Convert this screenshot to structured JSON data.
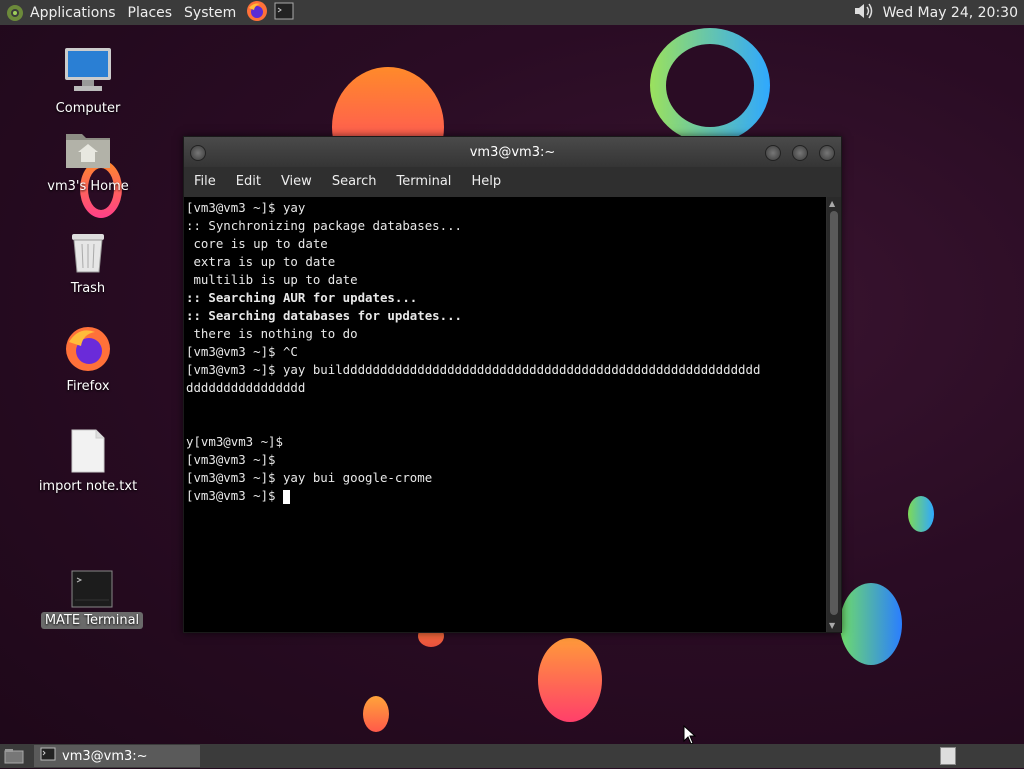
{
  "top_panel": {
    "menus": [
      "Applications",
      "Places",
      "System"
    ],
    "clock": "Wed May 24, 20:30"
  },
  "desktop_icons": [
    {
      "label": "Computer"
    },
    {
      "label": "vm3's Home"
    },
    {
      "label": "Trash"
    },
    {
      "label": "Firefox"
    },
    {
      "label": "import note.txt"
    },
    {
      "label": "MATE Terminal"
    }
  ],
  "window": {
    "title": "vm3@vm3:~",
    "menu": [
      "File",
      "Edit",
      "View",
      "Search",
      "Terminal",
      "Help"
    ]
  },
  "terminal_lines": [
    {
      "text": "[vm3@vm3 ~]$ yay",
      "bold": false
    },
    {
      "text": ":: Synchronizing package databases...",
      "bold": false
    },
    {
      "text": " core is up to date",
      "bold": false
    },
    {
      "text": " extra is up to date",
      "bold": false
    },
    {
      "text": " multilib is up to date",
      "bold": false
    },
    {
      "text": ":: Searching AUR for updates...",
      "bold": true
    },
    {
      "text": ":: Searching databases for updates...",
      "bold": true
    },
    {
      "text": " there is nothing to do",
      "bold": false
    },
    {
      "text": "[vm3@vm3 ~]$ ^C",
      "bold": false
    },
    {
      "text": "[vm3@vm3 ~]$ yay buildddddddddddddddddddddddddddddddddddddddddddddddddddddddd",
      "bold": false
    },
    {
      "text": "dddddddddddddddd",
      "bold": false
    },
    {
      "text": "",
      "bold": false
    },
    {
      "text": "",
      "bold": false
    },
    {
      "text": "y[vm3@vm3 ~]$",
      "bold": false
    },
    {
      "text": "[vm3@vm3 ~]$",
      "bold": false
    },
    {
      "text": "[vm3@vm3 ~]$ yay bui google-crome",
      "bold": false
    },
    {
      "text": "[vm3@vm3 ~]$ ",
      "bold": false,
      "cursor": true
    }
  ],
  "taskbar": {
    "task_label": "vm3@vm3:~"
  }
}
